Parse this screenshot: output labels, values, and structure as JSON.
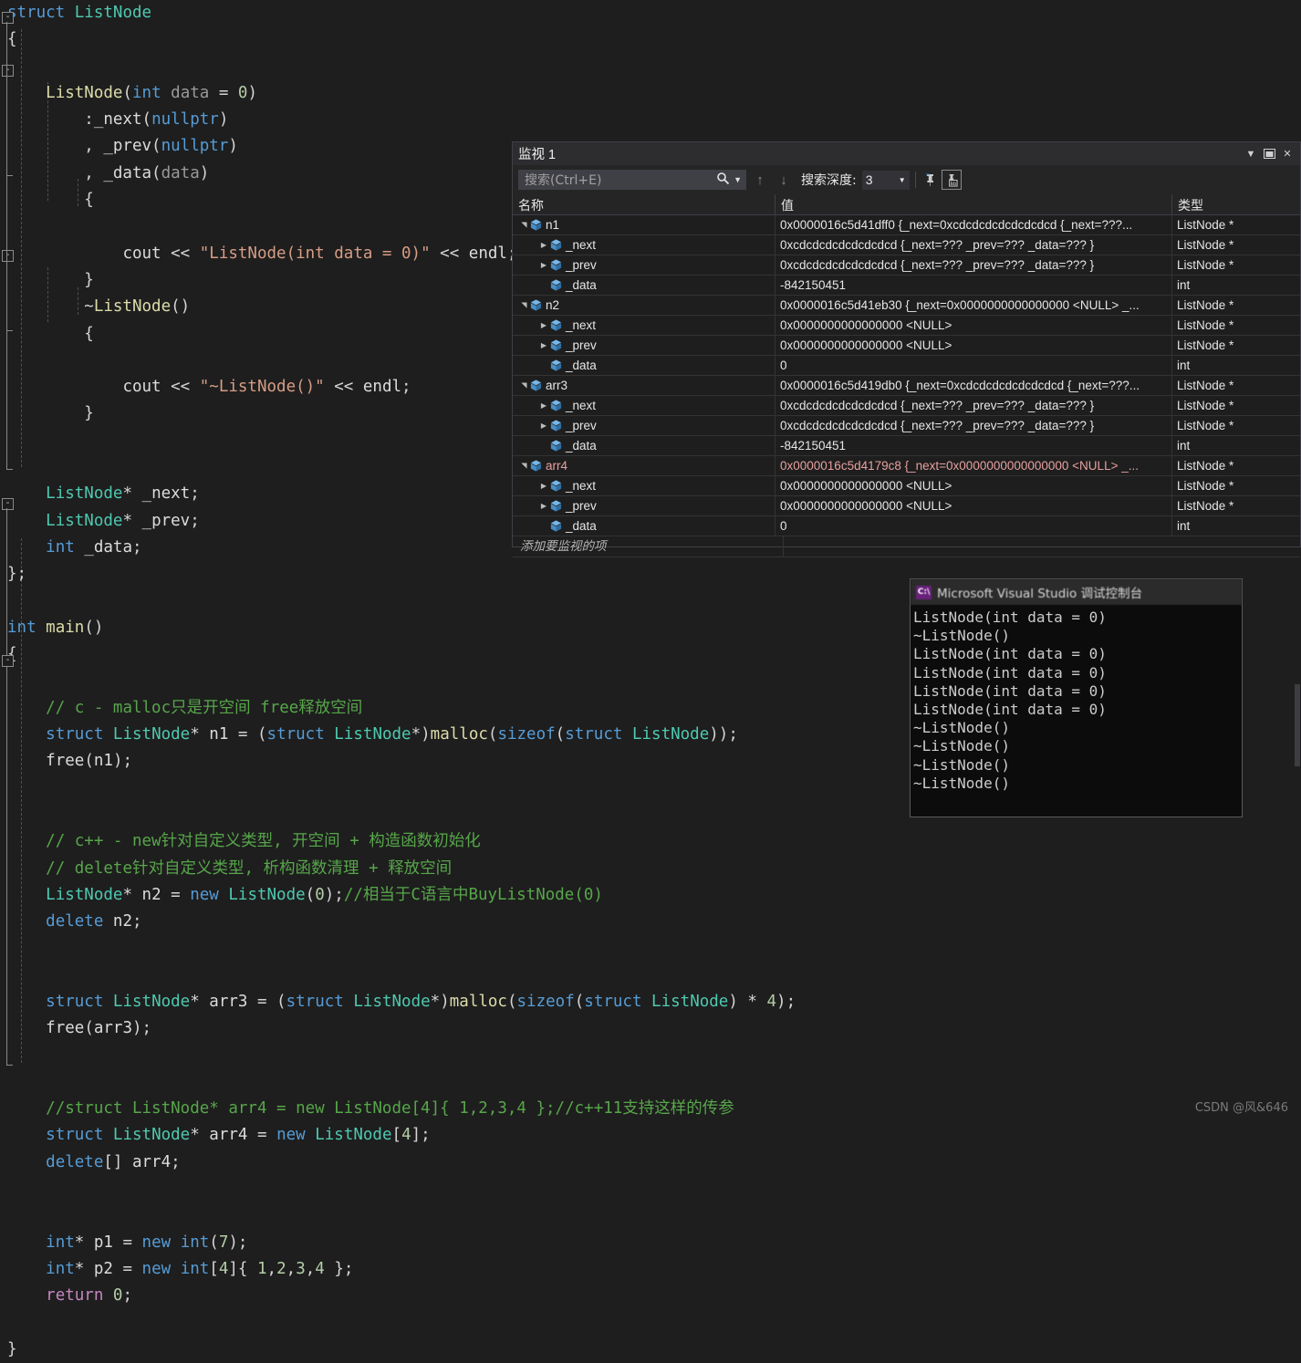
{
  "editor": {
    "lines": [
      [
        {
          "t": "struct ",
          "c": "kw"
        },
        {
          "t": "ListNode",
          "c": "typ"
        }
      ],
      [
        {
          "t": "{",
          "c": "op"
        }
      ],
      [],
      [
        {
          "t": "    ",
          "c": "op"
        },
        {
          "t": "ListNode",
          "c": "fn"
        },
        {
          "t": "(",
          "c": "op"
        },
        {
          "t": "int",
          "c": "kw"
        },
        {
          "t": " ",
          "c": "op"
        },
        {
          "t": "data",
          "c": "dim"
        },
        {
          "t": " = ",
          "c": "op"
        },
        {
          "t": "0",
          "c": "num"
        },
        {
          "t": ")",
          "c": "op"
        }
      ],
      [
        {
          "t": "        :",
          "c": "op"
        },
        {
          "t": "_next",
          "c": "pln"
        },
        {
          "t": "(",
          "c": "op"
        },
        {
          "t": "nullptr",
          "c": "kw"
        },
        {
          "t": ")",
          "c": "op"
        }
      ],
      [
        {
          "t": "        , ",
          "c": "op"
        },
        {
          "t": "_prev",
          "c": "pln"
        },
        {
          "t": "(",
          "c": "op"
        },
        {
          "t": "nullptr",
          "c": "kw"
        },
        {
          "t": ")",
          "c": "op"
        }
      ],
      [
        {
          "t": "        , ",
          "c": "op"
        },
        {
          "t": "_data",
          "c": "pln"
        },
        {
          "t": "(",
          "c": "op"
        },
        {
          "t": "data",
          "c": "dim"
        },
        {
          "t": ")",
          "c": "op"
        }
      ],
      [
        {
          "t": "        {",
          "c": "op"
        }
      ],
      [],
      [
        {
          "t": "            ",
          "c": "op"
        },
        {
          "t": "cout",
          "c": "pln"
        },
        {
          "t": " << ",
          "c": "op"
        },
        {
          "t": "\"ListNode(int data = 0)\"",
          "c": "str"
        },
        {
          "t": " << ",
          "c": "op"
        },
        {
          "t": "endl",
          "c": "pln"
        },
        {
          "t": ";",
          "c": "op"
        }
      ],
      [
        {
          "t": "        }",
          "c": "op"
        }
      ],
      [
        {
          "t": "        ~",
          "c": "op"
        },
        {
          "t": "ListNode",
          "c": "fn"
        },
        {
          "t": "()",
          "c": "op"
        }
      ],
      [
        {
          "t": "        {",
          "c": "op"
        }
      ],
      [],
      [
        {
          "t": "            ",
          "c": "op"
        },
        {
          "t": "cout",
          "c": "pln"
        },
        {
          "t": " << ",
          "c": "op"
        },
        {
          "t": "\"~ListNode()\"",
          "c": "str"
        },
        {
          "t": " << ",
          "c": "op"
        },
        {
          "t": "endl",
          "c": "pln"
        },
        {
          "t": ";",
          "c": "op"
        }
      ],
      [
        {
          "t": "        }",
          "c": "op"
        }
      ],
      [],
      [],
      [
        {
          "t": "    ",
          "c": "op"
        },
        {
          "t": "ListNode",
          "c": "typ"
        },
        {
          "t": "* ",
          "c": "op"
        },
        {
          "t": "_next",
          "c": "pln"
        },
        {
          "t": ";",
          "c": "op"
        }
      ],
      [
        {
          "t": "    ",
          "c": "op"
        },
        {
          "t": "ListNode",
          "c": "typ"
        },
        {
          "t": "* ",
          "c": "op"
        },
        {
          "t": "_prev",
          "c": "pln"
        },
        {
          "t": ";",
          "c": "op"
        }
      ],
      [
        {
          "t": "    ",
          "c": "op"
        },
        {
          "t": "int",
          "c": "kw"
        },
        {
          "t": " ",
          "c": "op"
        },
        {
          "t": "_data",
          "c": "pln"
        },
        {
          "t": ";",
          "c": "op"
        }
      ],
      [
        {
          "t": "};",
          "c": "op"
        }
      ],
      [],
      [
        {
          "t": "int",
          "c": "kw"
        },
        {
          "t": " ",
          "c": "op"
        },
        {
          "t": "main",
          "c": "fn"
        },
        {
          "t": "()",
          "c": "op"
        }
      ],
      [
        {
          "t": "{",
          "c": "op"
        }
      ],
      [],
      [
        {
          "t": "    ",
          "c": "op"
        },
        {
          "t": "// c - malloc只是开空间 free释放空间",
          "c": "cmt"
        }
      ],
      [
        {
          "t": "    ",
          "c": "op"
        },
        {
          "t": "struct ",
          "c": "kw"
        },
        {
          "t": "ListNode",
          "c": "typ"
        },
        {
          "t": "* ",
          "c": "op"
        },
        {
          "t": "n1",
          "c": "pln"
        },
        {
          "t": " = (",
          "c": "op"
        },
        {
          "t": "struct ",
          "c": "kw"
        },
        {
          "t": "ListNode",
          "c": "typ"
        },
        {
          "t": "*)",
          "c": "op"
        },
        {
          "t": "malloc",
          "c": "fn"
        },
        {
          "t": "(",
          "c": "op"
        },
        {
          "t": "sizeof",
          "c": "kw"
        },
        {
          "t": "(",
          "c": "op"
        },
        {
          "t": "struct ",
          "c": "kw"
        },
        {
          "t": "ListNode",
          "c": "typ"
        },
        {
          "t": "));",
          "c": "op"
        }
      ],
      [
        {
          "t": "    ",
          "c": "op"
        },
        {
          "t": "free",
          "c": "pln"
        },
        {
          "t": "(",
          "c": "op"
        },
        {
          "t": "n1",
          "c": "pln"
        },
        {
          "t": ");",
          "c": "op"
        }
      ],
      [],
      [],
      [
        {
          "t": "    ",
          "c": "op"
        },
        {
          "t": "// c++ - new针对自定义类型, 开空间 + 构造函数初始化",
          "c": "cmt"
        }
      ],
      [
        {
          "t": "    ",
          "c": "op"
        },
        {
          "t": "// delete针对自定义类型, 析构函数清理 + 释放空间",
          "c": "cmt"
        }
      ],
      [
        {
          "t": "    ",
          "c": "op"
        },
        {
          "t": "ListNode",
          "c": "typ"
        },
        {
          "t": "* ",
          "c": "op"
        },
        {
          "t": "n2",
          "c": "pln"
        },
        {
          "t": " = ",
          "c": "op"
        },
        {
          "t": "new ",
          "c": "kw"
        },
        {
          "t": "ListNode",
          "c": "typ"
        },
        {
          "t": "(",
          "c": "op"
        },
        {
          "t": "0",
          "c": "num"
        },
        {
          "t": ");",
          "c": "op"
        },
        {
          "t": "//相当于C语言中BuyListNode(0)",
          "c": "cmt"
        }
      ],
      [
        {
          "t": "    ",
          "c": "op"
        },
        {
          "t": "delete ",
          "c": "kw"
        },
        {
          "t": "n2",
          "c": "pln"
        },
        {
          "t": ";",
          "c": "op"
        }
      ],
      [],
      [],
      [
        {
          "t": "    ",
          "c": "op"
        },
        {
          "t": "struct ",
          "c": "kw"
        },
        {
          "t": "ListNode",
          "c": "typ"
        },
        {
          "t": "* ",
          "c": "op"
        },
        {
          "t": "arr3",
          "c": "pln"
        },
        {
          "t": " = (",
          "c": "op"
        },
        {
          "t": "struct ",
          "c": "kw"
        },
        {
          "t": "ListNode",
          "c": "typ"
        },
        {
          "t": "*)",
          "c": "op"
        },
        {
          "t": "malloc",
          "c": "fn"
        },
        {
          "t": "(",
          "c": "op"
        },
        {
          "t": "sizeof",
          "c": "kw"
        },
        {
          "t": "(",
          "c": "op"
        },
        {
          "t": "struct ",
          "c": "kw"
        },
        {
          "t": "ListNode",
          "c": "typ"
        },
        {
          "t": ") * ",
          "c": "op"
        },
        {
          "t": "4",
          "c": "num"
        },
        {
          "t": ");",
          "c": "op"
        }
      ],
      [
        {
          "t": "    ",
          "c": "op"
        },
        {
          "t": "free",
          "c": "pln"
        },
        {
          "t": "(",
          "c": "op"
        },
        {
          "t": "arr3",
          "c": "pln"
        },
        {
          "t": ");",
          "c": "op"
        }
      ],
      [],
      [],
      [
        {
          "t": "    ",
          "c": "op"
        },
        {
          "t": "//struct ListNode* arr4 = new ListNode[4]{ 1,2,3,4 };//c++11支持这样的传参",
          "c": "cmt"
        }
      ],
      [
        {
          "t": "    ",
          "c": "op"
        },
        {
          "t": "struct ",
          "c": "kw"
        },
        {
          "t": "ListNode",
          "c": "typ"
        },
        {
          "t": "* ",
          "c": "op"
        },
        {
          "t": "arr4",
          "c": "pln"
        },
        {
          "t": " = ",
          "c": "op"
        },
        {
          "t": "new ",
          "c": "kw"
        },
        {
          "t": "ListNode",
          "c": "typ"
        },
        {
          "t": "[",
          "c": "op"
        },
        {
          "t": "4",
          "c": "num"
        },
        {
          "t": "];",
          "c": "op"
        }
      ],
      [
        {
          "t": "    ",
          "c": "op"
        },
        {
          "t": "delete",
          "c": "kw"
        },
        {
          "t": "[] ",
          "c": "op"
        },
        {
          "t": "arr4",
          "c": "pln"
        },
        {
          "t": ";",
          "c": "op"
        }
      ],
      [],
      [],
      [
        {
          "t": "    ",
          "c": "op"
        },
        {
          "t": "int",
          "c": "kw"
        },
        {
          "t": "* ",
          "c": "op"
        },
        {
          "t": "p1",
          "c": "pln"
        },
        {
          "t": " = ",
          "c": "op"
        },
        {
          "t": "new ",
          "c": "kw"
        },
        {
          "t": "int",
          "c": "kw"
        },
        {
          "t": "(",
          "c": "op"
        },
        {
          "t": "7",
          "c": "num"
        },
        {
          "t": ");",
          "c": "op"
        }
      ],
      [
        {
          "t": "    ",
          "c": "op"
        },
        {
          "t": "int",
          "c": "kw"
        },
        {
          "t": "* ",
          "c": "op"
        },
        {
          "t": "p2",
          "c": "pln"
        },
        {
          "t": " = ",
          "c": "op"
        },
        {
          "t": "new ",
          "c": "kw"
        },
        {
          "t": "int",
          "c": "kw"
        },
        {
          "t": "[",
          "c": "op"
        },
        {
          "t": "4",
          "c": "num"
        },
        {
          "t": "]{ ",
          "c": "op"
        },
        {
          "t": "1",
          "c": "num"
        },
        {
          "t": ",",
          "c": "op"
        },
        {
          "t": "2",
          "c": "num"
        },
        {
          "t": ",",
          "c": "op"
        },
        {
          "t": "3",
          "c": "num"
        },
        {
          "t": ",",
          "c": "op"
        },
        {
          "t": "4",
          "c": "num"
        },
        {
          "t": " };",
          "c": "op"
        }
      ],
      [
        {
          "t": "    ",
          "c": "op"
        },
        {
          "t": "return ",
          "c": "kw2"
        },
        {
          "t": "0",
          "c": "num"
        },
        {
          "t": ";",
          "c": "op"
        }
      ],
      [],
      [
        {
          "t": "}",
          "c": "op"
        }
      ]
    ]
  },
  "watch": {
    "title": "监视 1",
    "title_buttons": {
      "dropdown": "chevron-down-icon",
      "pin": "window-icon",
      "close": "close-icon"
    },
    "search": {
      "placeholder": "搜索(Ctrl+E)",
      "value": "",
      "icon": "search-icon",
      "dropdown": "chevron-down-icon"
    },
    "nav": {
      "up": "arrow-up-icon",
      "down": "arrow-down-icon"
    },
    "depth_label": "搜索深度:",
    "depth_value": "3",
    "columns": [
      "名称",
      "值",
      "类型"
    ],
    "add_item_placeholder": "添加要监视的项",
    "rows": [
      {
        "indent": 0,
        "expanded": true,
        "name": "n1",
        "value": "0x0000016c5d41dff0 {_next=0xcdcdcdcdcdcdcdcd {_next=???...",
        "type": "ListNode *",
        "modified": false
      },
      {
        "indent": 1,
        "expanded": false,
        "name": "_next",
        "value": "0xcdcdcdcdcdcdcdcd {_next=??? _prev=??? _data=??? }",
        "type": "ListNode *",
        "modified": false
      },
      {
        "indent": 1,
        "expanded": false,
        "name": "_prev",
        "value": "0xcdcdcdcdcdcdcdcd {_next=??? _prev=??? _data=??? }",
        "type": "ListNode *",
        "modified": false
      },
      {
        "indent": 1,
        "expanded": null,
        "name": "_data",
        "value": "-842150451",
        "type": "int",
        "modified": false
      },
      {
        "indent": 0,
        "expanded": true,
        "name": "n2",
        "value": "0x0000016c5d41eb30 {_next=0x0000000000000000 <NULL> _...",
        "type": "ListNode *",
        "modified": false
      },
      {
        "indent": 1,
        "expanded": false,
        "name": "_next",
        "value": "0x0000000000000000 <NULL>",
        "type": "ListNode *",
        "modified": false
      },
      {
        "indent": 1,
        "expanded": false,
        "name": "_prev",
        "value": "0x0000000000000000 <NULL>",
        "type": "ListNode *",
        "modified": false
      },
      {
        "indent": 1,
        "expanded": null,
        "name": "_data",
        "value": "0",
        "type": "int",
        "modified": false
      },
      {
        "indent": 0,
        "expanded": true,
        "name": "arr3",
        "value": "0x0000016c5d419db0 {_next=0xcdcdcdcdcdcdcdcd {_next=???...",
        "type": "ListNode *",
        "modified": false
      },
      {
        "indent": 1,
        "expanded": false,
        "name": "_next",
        "value": "0xcdcdcdcdcdcdcdcd {_next=??? _prev=??? _data=??? }",
        "type": "ListNode *",
        "modified": false
      },
      {
        "indent": 1,
        "expanded": false,
        "name": "_prev",
        "value": "0xcdcdcdcdcdcdcdcd {_next=??? _prev=??? _data=??? }",
        "type": "ListNode *",
        "modified": false
      },
      {
        "indent": 1,
        "expanded": null,
        "name": "_data",
        "value": "-842150451",
        "type": "int",
        "modified": false
      },
      {
        "indent": 0,
        "expanded": true,
        "name": "arr4",
        "value": "0x0000016c5d4179c8 {_next=0x0000000000000000 <NULL> _...",
        "type": "ListNode *",
        "modified": true
      },
      {
        "indent": 1,
        "expanded": false,
        "name": "_next",
        "value": "0x0000000000000000 <NULL>",
        "type": "ListNode *",
        "modified": false
      },
      {
        "indent": 1,
        "expanded": false,
        "name": "_prev",
        "value": "0x0000000000000000 <NULL>",
        "type": "ListNode *",
        "modified": false
      },
      {
        "indent": 1,
        "expanded": null,
        "name": "_data",
        "value": "0",
        "type": "int",
        "modified": false
      }
    ]
  },
  "console": {
    "title": "Microsoft Visual Studio 调试控制台",
    "icon_label": "C:\\",
    "output": "ListNode(int data = 0)\n~ListNode()\nListNode(int data = 0)\nListNode(int data = 0)\nListNode(int data = 0)\nListNode(int data = 0)\n~ListNode()\n~ListNode()\n~ListNode()\n~ListNode()"
  },
  "watermark": "CSDN @风&646",
  "colors": {
    "editor_bg": "#1e1e1e",
    "watch_bg": "#252526",
    "console_bg": "#0c0c0c",
    "modified_value": "#e8a0a0",
    "keyword": "#569cd6",
    "type": "#4ec9b0",
    "string": "#d69d85",
    "comment": "#57a64a",
    "function": "#dcdcaa"
  }
}
